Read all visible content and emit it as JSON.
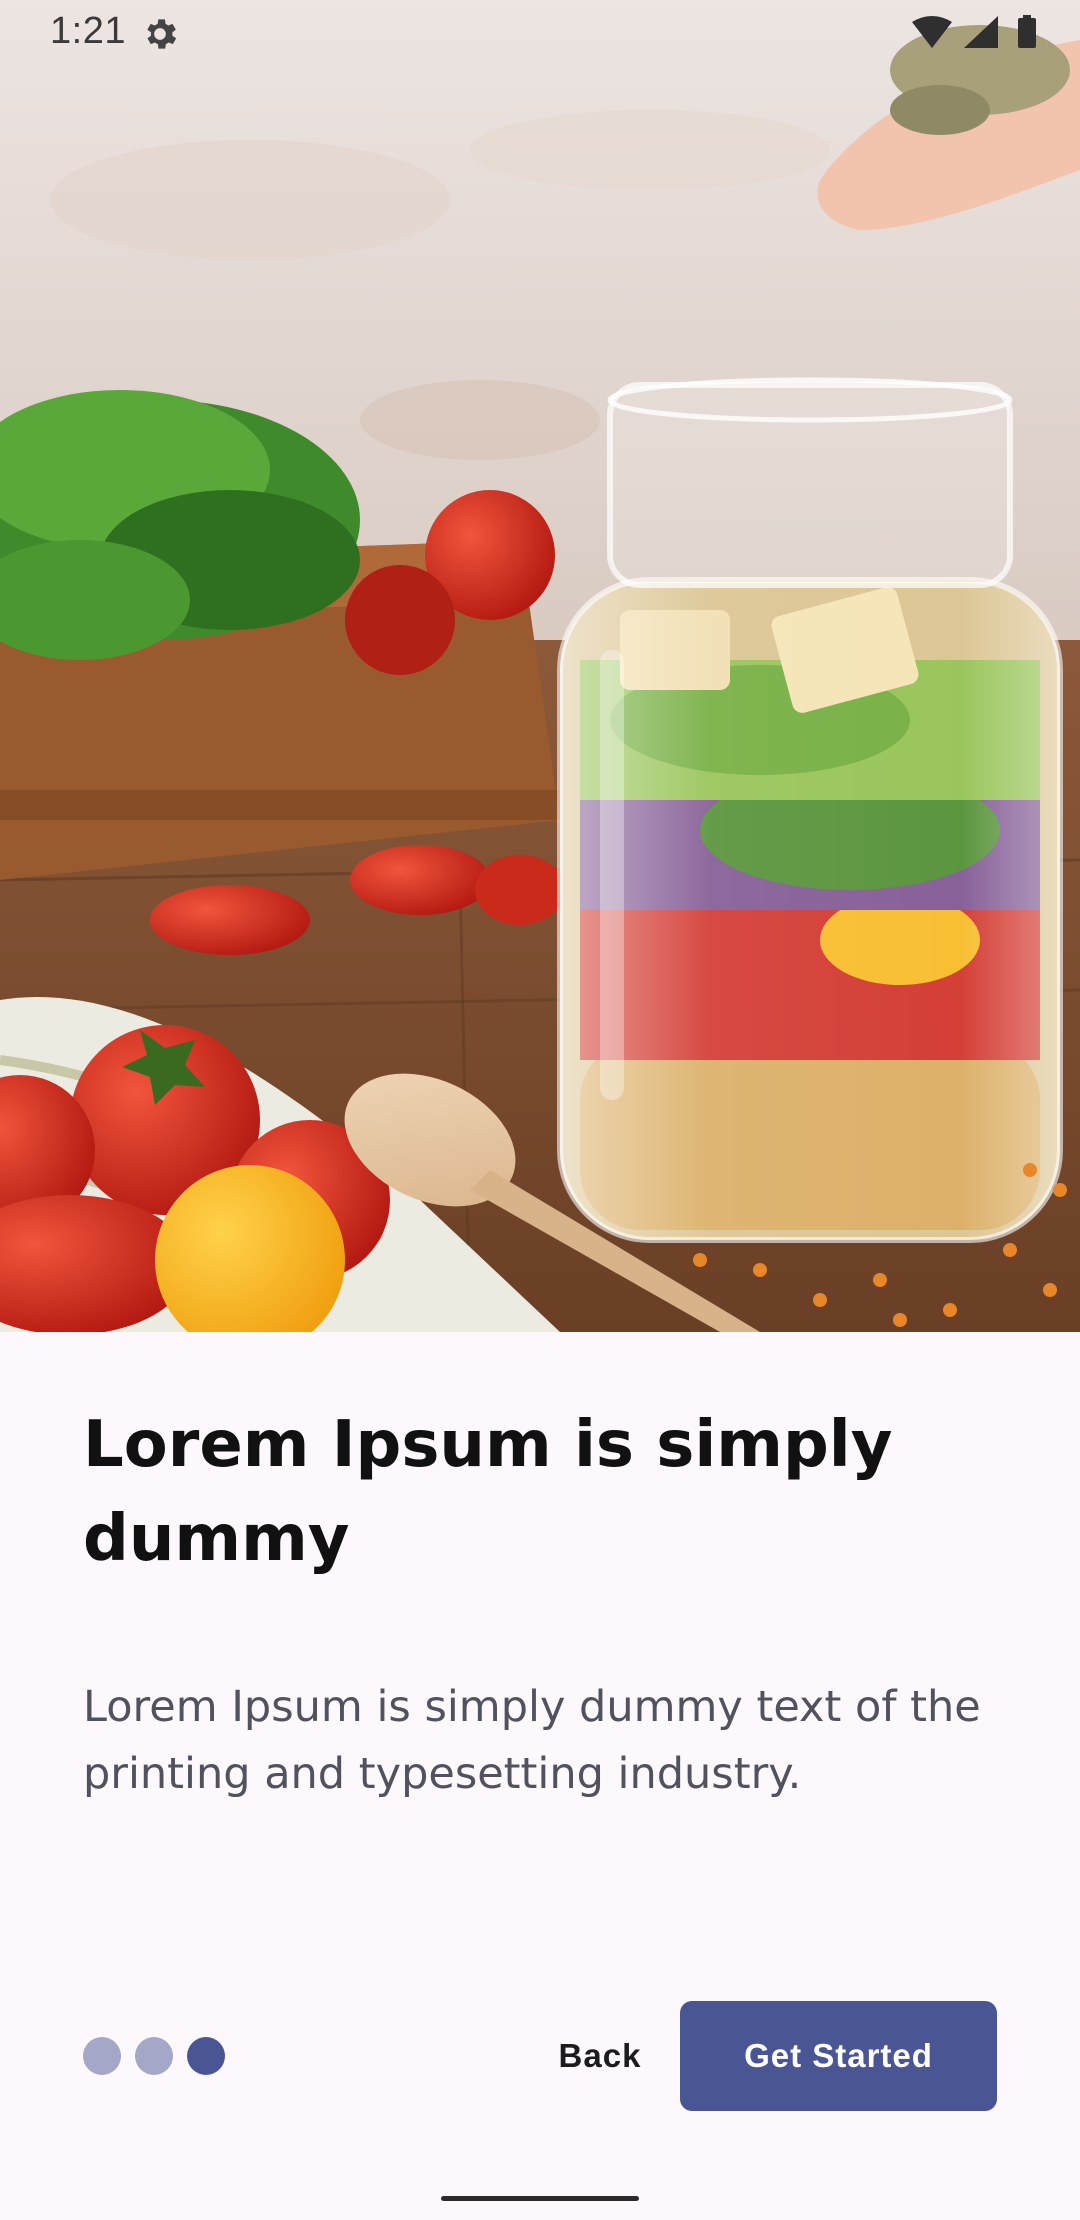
{
  "status_bar": {
    "time": "1:21",
    "left_icon": "gear-icon",
    "right_icons": [
      "wifi-icon",
      "signal-icon",
      "battery-icon"
    ]
  },
  "hero": {
    "image": "food-photo: mason jar salad with vegetables, tomatoes and wooden spoon"
  },
  "onboarding": {
    "title": "Lorem Ipsum is simply dummy",
    "description": "Lorem Ipsum is simply dummy text of the printing and typesetting industry.",
    "page_count": 3,
    "current_page": 3
  },
  "actions": {
    "back_label": "Back",
    "primary_label": "Get Started"
  },
  "colors": {
    "accent": "#4a5594",
    "indicator_inactive": "#a4a7c7",
    "background": "#fcf8fc",
    "title_text": "#111111",
    "body_text": "#52525e"
  }
}
